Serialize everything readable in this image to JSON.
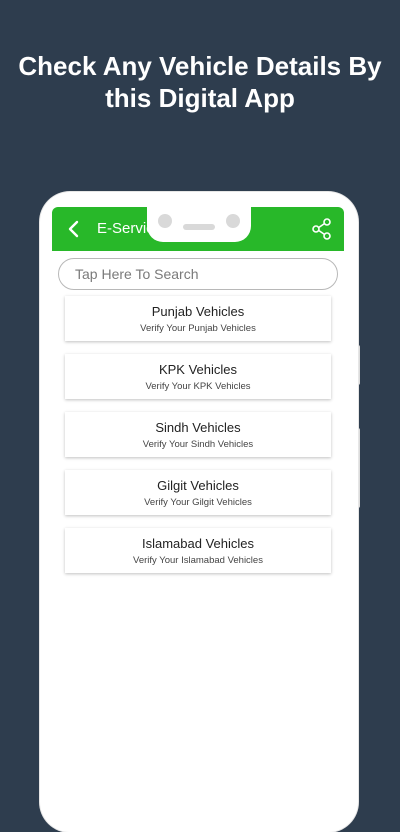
{
  "promo": {
    "line1": "Check Any Vehicle Details By",
    "line2": "this Digital App"
  },
  "app_bar": {
    "title": "E-Servic",
    "back_icon": "back-arrow-icon",
    "share_icon": "share-icon"
  },
  "search": {
    "placeholder": "Tap Here To Search",
    "value": ""
  },
  "vehicles": [
    {
      "title": "Punjab Vehicles",
      "subtitle": "Verify Your Punjab Vehicles"
    },
    {
      "title": "KPK Vehicles",
      "subtitle": "Verify Your KPK Vehicles"
    },
    {
      "title": "Sindh Vehicles",
      "subtitle": "Verify Your Sindh Vehicles"
    },
    {
      "title": "Gilgit Vehicles",
      "subtitle": "Verify Your Gilgit Vehicles"
    },
    {
      "title": "Islamabad Vehicles",
      "subtitle": "Verify Your Islamabad Vehicles"
    }
  ],
  "colors": {
    "background": "#2e3d4e",
    "app_bar": "#28b829",
    "text_white": "#ffffff"
  }
}
